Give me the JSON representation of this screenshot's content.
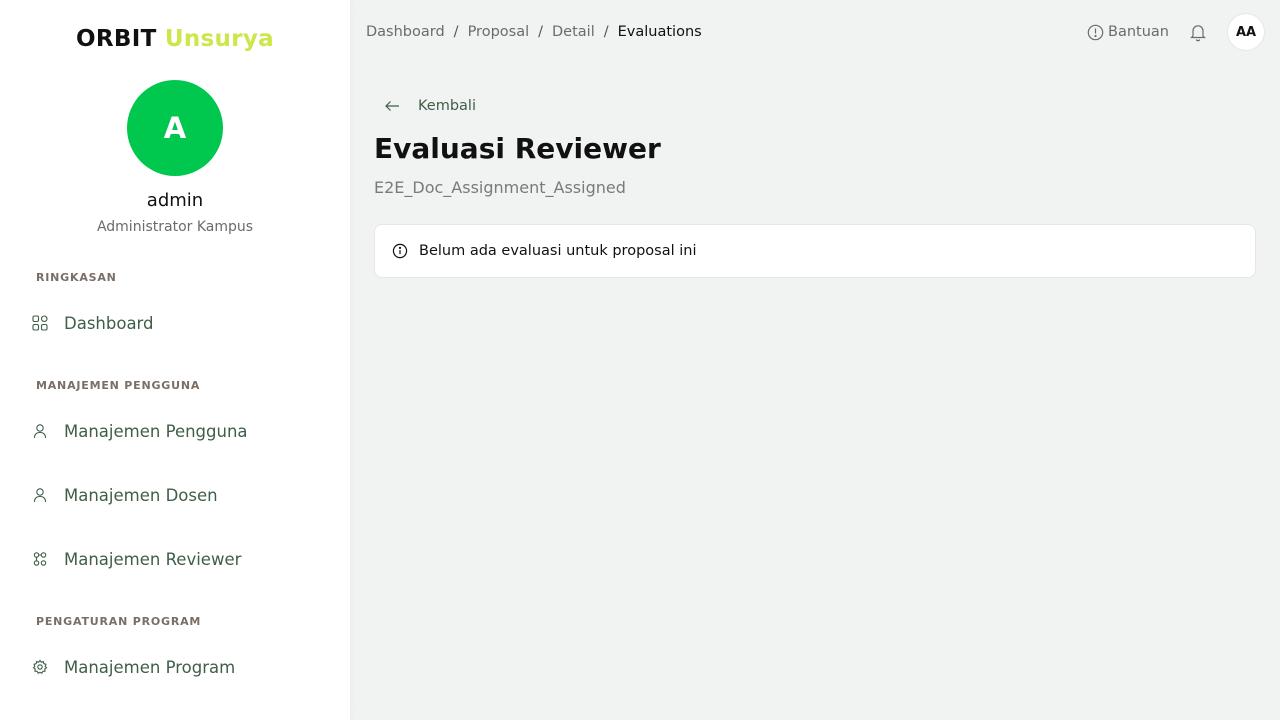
{
  "sidebar": {
    "brand_part1": "ORBIT",
    "brand_part2": "Unsurya",
    "avatar_initial": "A",
    "user_name": "admin",
    "user_role": "Administrator Kampus",
    "sections": [
      {
        "label": "RINGKASAN",
        "items": [
          {
            "label": "Dashboard",
            "icon": "grid-icon"
          }
        ]
      },
      {
        "label": "MANAJEMEN PENGGUNA",
        "items": [
          {
            "label": "Manajemen Pengguna",
            "icon": "user-icon"
          },
          {
            "label": "Manajemen Dosen",
            "icon": "user-icon"
          },
          {
            "label": "Manajemen Reviewer",
            "icon": "users-network-icon"
          }
        ]
      },
      {
        "label": "PENGATURAN PROGRAM",
        "items": [
          {
            "label": "Manajemen Program",
            "icon": "gear-icon"
          }
        ]
      }
    ]
  },
  "header": {
    "breadcrumb": [
      "Dashboard",
      "Proposal",
      "Detail",
      "Evaluations"
    ],
    "breadcrumb_separator": "/",
    "help_label": "Bantuan",
    "avatar_initials": "AA"
  },
  "main": {
    "back_label": "Kembali",
    "title": "Evaluasi Reviewer",
    "subtitle": "E2E_Doc_Assignment_Assigned",
    "alert_text": "Belum ada evaluasi untuk proposal ini"
  },
  "colors": {
    "accent_green": "#00c84f",
    "brand_lime": "#cde64a",
    "nav_text": "#3f5e47",
    "background": "#f0f3f2"
  }
}
